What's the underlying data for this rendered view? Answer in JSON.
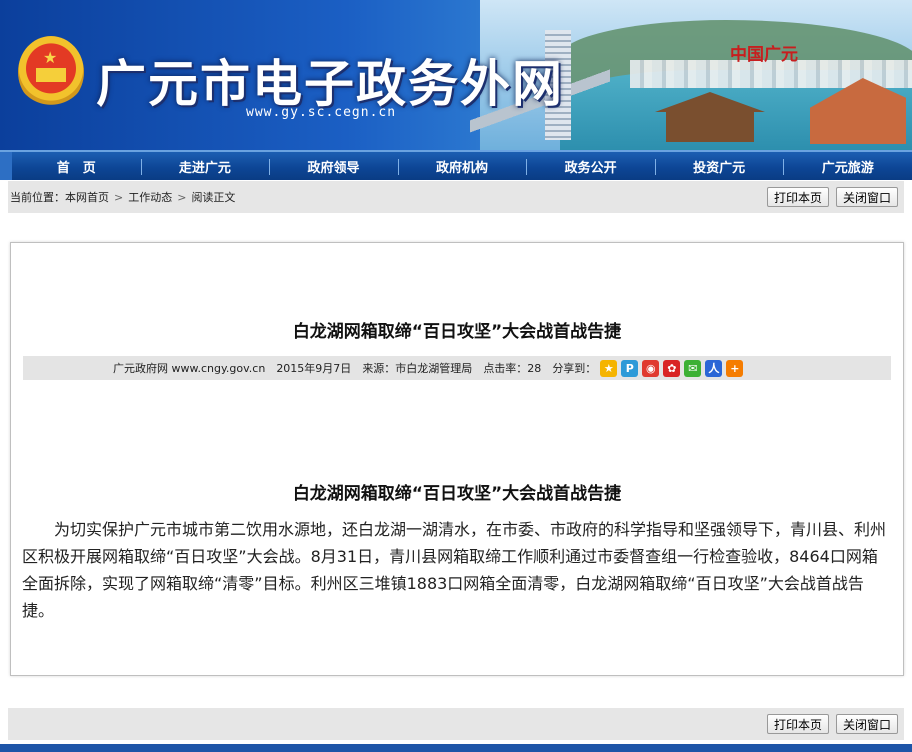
{
  "header": {
    "site_title": "广元市电子政务外网",
    "site_url": "www.gy.sc.cegn.cn",
    "region_label": "中国广元"
  },
  "nav": {
    "items": [
      "首　页",
      "走进广元",
      "政府领导",
      "政府机构",
      "政务公开",
      "投资广元",
      "广元旅游"
    ]
  },
  "breadcrumb": {
    "prefix": "当前位置：",
    "items": [
      "本网首页",
      "工作动态",
      "阅读正文"
    ],
    "separator": ">"
  },
  "toolbar": {
    "print_label": "打印本页",
    "close_label": "关闭窗口"
  },
  "article": {
    "title": "白龙湖网箱取缔“百日攻坚”大会战首战告捷",
    "meta": {
      "site": "广元政府网 www.cngy.gov.cn",
      "date": "2015年9月7日",
      "source": "来源：市白龙湖管理局",
      "clicks": "点击率：28",
      "share_label": "分享到："
    },
    "share_icons": [
      {
        "name": "qzone-icon",
        "color": "#f5b400",
        "glyph": "★"
      },
      {
        "name": "tencent-weibo-icon",
        "color": "#2d9ad8",
        "glyph": "P"
      },
      {
        "name": "sina-weibo-icon",
        "color": "#e03a2f",
        "glyph": "◉"
      },
      {
        "name": "renren-icon",
        "color": "#d92424",
        "glyph": "✿"
      },
      {
        "name": "wechat-icon",
        "color": "#3cb034",
        "glyph": "✉"
      },
      {
        "name": "baidu-icon",
        "color": "#2a66d6",
        "glyph": "人"
      },
      {
        "name": "more-share-icon",
        "color": "#f57c00",
        "glyph": "+"
      }
    ],
    "body_title": "白龙湖网箱取缔“百日攻坚”大会战首战告捷",
    "body": "为切实保护广元市城市第二饮用水源地，还白龙湖一湖清水，在市委、市政府的科学指导和坚强领导下，青川县、利州区积极开展网箱取缔“百日攻坚”大会战。8月31日，青川县网箱取缔工作顺利通过市委督查组一行检查验收，8464口网箱全面拆除，实现了网箱取缔“清零”目标。利州区三堆镇1883口网箱全面清零，白龙湖网箱取缔“百日攻坚”大会战首战告捷。"
  },
  "colors": {
    "nav_bg": "#0d4696",
    "accent_red": "#c81e1e",
    "bar_gray": "#e6e6e6"
  }
}
